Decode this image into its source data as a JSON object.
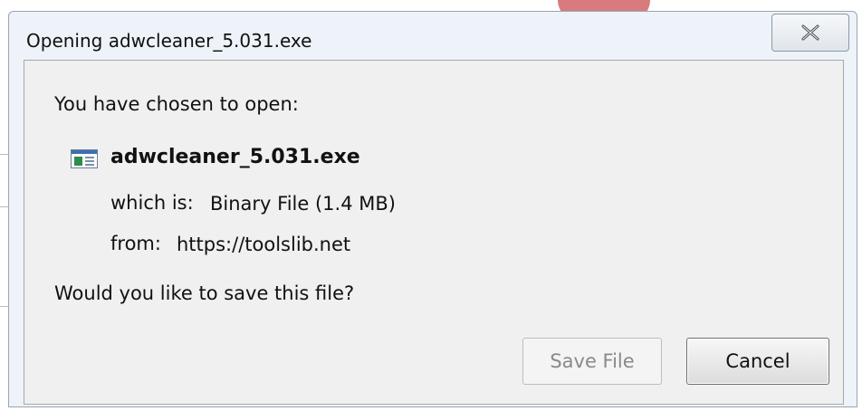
{
  "window": {
    "title": "Opening adwcleaner_5.031.exe"
  },
  "dialog": {
    "intro": "You have chosen to open:",
    "file_name": "adwcleaner_5.031.exe",
    "which_is_label": "which is:",
    "which_is_value": "Binary File (1.4 MB)",
    "from_label": "from:",
    "from_value": "https://toolslib.net",
    "question": "Would you like to save this file?"
  },
  "buttons": {
    "save": "Save File",
    "cancel": "Cancel"
  },
  "icons": {
    "close": "close-icon",
    "file": "executable-file-icon"
  }
}
